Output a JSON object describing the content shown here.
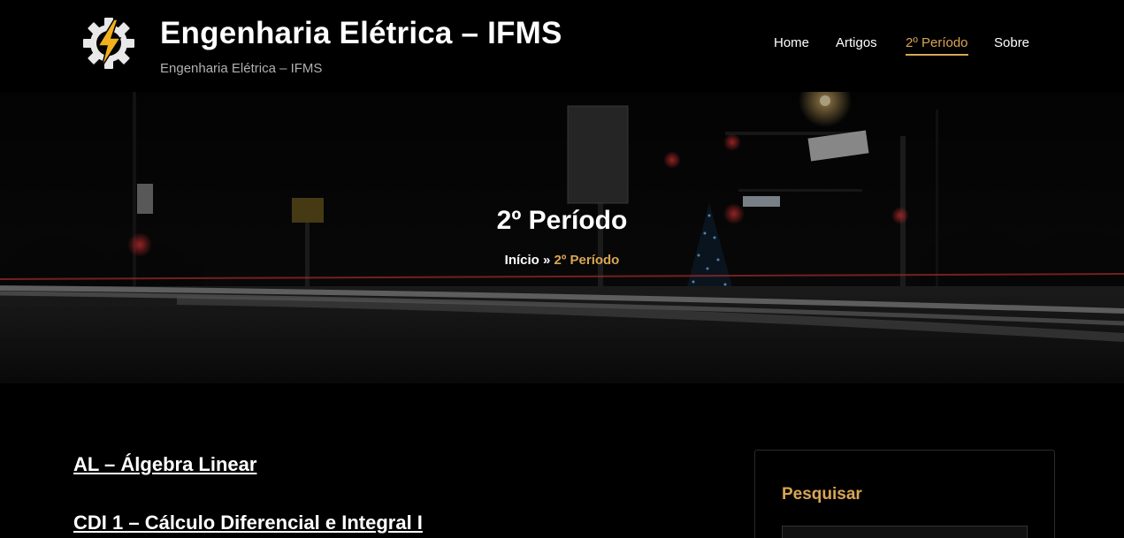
{
  "header": {
    "site_title": "Engenharia Elétrica – IFMS",
    "tagline": "Engenharia Elétrica – IFMS",
    "logo_icon": "gear-lightning-icon"
  },
  "nav": {
    "items": [
      {
        "label": "Home",
        "active": false
      },
      {
        "label": "Artigos",
        "active": false
      },
      {
        "label": "2º Período",
        "active": true
      },
      {
        "label": "Sobre",
        "active": false
      }
    ]
  },
  "hero": {
    "title": "2º Período",
    "breadcrumb": {
      "home": "Início",
      "separator": "»",
      "current": "2º Período"
    }
  },
  "posts": [
    {
      "title": "AL – Álgebra Linear"
    },
    {
      "title": "CDI 1 – Cálculo Diferencial e Integral I"
    }
  ],
  "sidebar": {
    "widget_title": "Pesquisar",
    "search_placeholder": ""
  },
  "colors": {
    "accent": "#d9a555",
    "background": "#000000",
    "text": "#ffffff"
  }
}
